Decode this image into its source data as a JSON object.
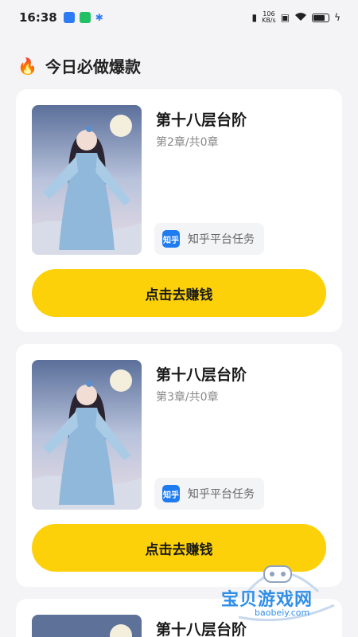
{
  "status": {
    "time": "16:38",
    "net_speed_value": "106",
    "net_speed_unit": "KB/s"
  },
  "section": {
    "icon": "fire-icon",
    "title": "今日必做爆款"
  },
  "cards": [
    {
      "title": "第十八层台阶",
      "chapter": "第2章/共0章",
      "platform_icon_text": "知乎",
      "platform": "知乎平台任务",
      "button": "点击去赚钱"
    },
    {
      "title": "第十八层台阶",
      "chapter": "第3章/共0章",
      "platform_icon_text": "知乎",
      "platform": "知乎平台任务",
      "button": "点击去赚钱"
    },
    {
      "title": "第十八层台阶"
    }
  ],
  "watermark": {
    "text": "宝贝游戏网",
    "url": "baobeiy.com"
  },
  "colors": {
    "accent_button": "#fcd10a",
    "zhihu_blue": "#1e7bf0",
    "background": "#f4f4f6"
  }
}
